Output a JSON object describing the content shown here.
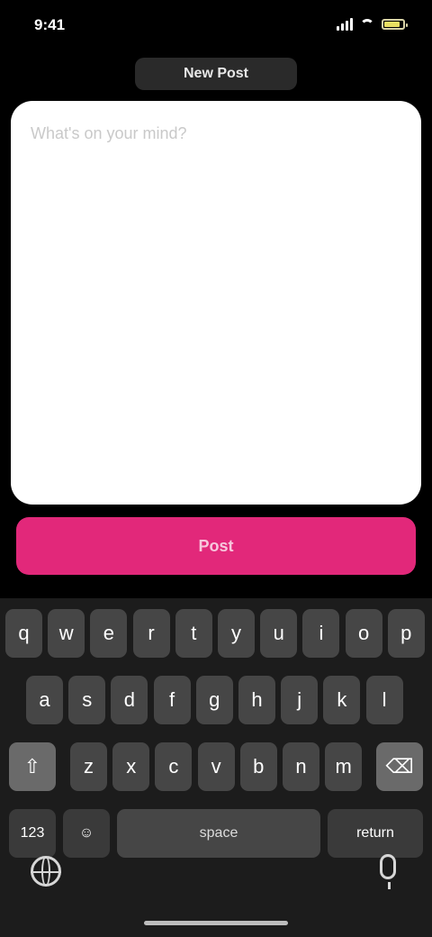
{
  "status_bar": {
    "time": "9:41",
    "battery_level": 0.85,
    "colors": {
      "battery": "#e9df62"
    }
  },
  "header": {
    "title": "New Post"
  },
  "editor": {
    "placeholder": "What's on your mind?",
    "value": ""
  },
  "submit": {
    "label": "Post",
    "color": "#e2287a"
  },
  "keyboard": {
    "row1": [
      "q",
      "w",
      "e",
      "r",
      "t",
      "y",
      "u",
      "i",
      "o",
      "p"
    ],
    "row2": [
      "a",
      "s",
      "d",
      "f",
      "g",
      "h",
      "j",
      "k",
      "l"
    ],
    "row3": [
      "z",
      "x",
      "c",
      "v",
      "b",
      "n",
      "m"
    ],
    "shift_icon": "shift-icon",
    "backspace_icon": "backspace-icon",
    "numbers_label": "123",
    "emoji_icon": "emoji-icon",
    "space_label": "space",
    "return_label": "return",
    "globe_icon": "globe-icon",
    "mic_icon": "mic-icon"
  }
}
